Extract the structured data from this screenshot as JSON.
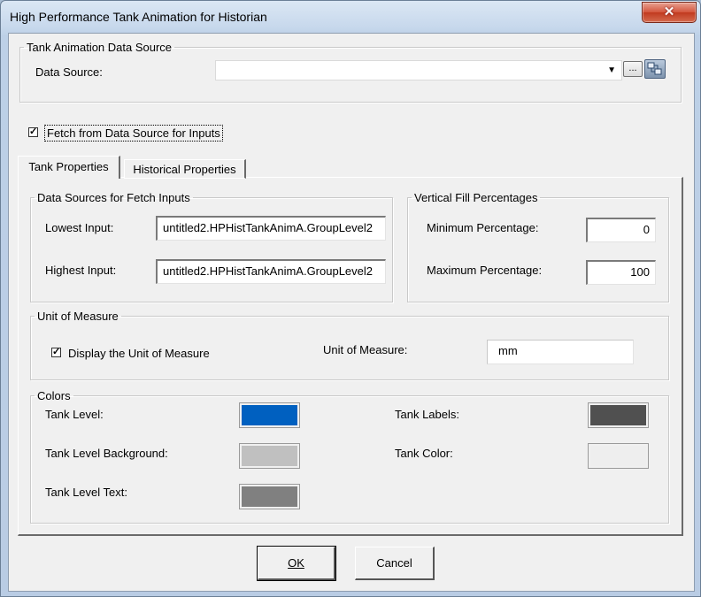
{
  "window": {
    "title": "High Performance Tank Animation for Historian",
    "close_label": "✕"
  },
  "data_source_group": {
    "legend": "Tank Animation Data Source",
    "label": "Data Source:",
    "value": "",
    "browse_label": "...",
    "browse_icon": "tag-browser-icon"
  },
  "fetch": {
    "checked": true,
    "label": "Fetch from Data Source for Inputs"
  },
  "tabs": [
    {
      "label": "Tank Properties",
      "active": true
    },
    {
      "label": "Historical Properties",
      "active": false
    }
  ],
  "fetch_inputs": {
    "legend": "Data Sources for Fetch Inputs",
    "lowest_label": "Lowest Input:",
    "lowest_value": "untitled2.HPHistTankAnimA.GroupLevel2",
    "highest_label": "Highest Input:",
    "highest_value": "untitled2.HPHistTankAnimA.GroupLevel2"
  },
  "fill": {
    "legend": "Vertical Fill Percentages",
    "min_label": "Minimum Percentage:",
    "min_value": "0",
    "max_label": "Maximum Percentage:",
    "max_value": "100"
  },
  "uom": {
    "legend": "Unit of Measure",
    "display_checked": true,
    "display_label": "Display the Unit of Measure",
    "label": "Unit of Measure:",
    "value": "mm"
  },
  "colors": {
    "legend": "Colors",
    "tank_level": {
      "label": "Tank Level:",
      "color": "#0060c0"
    },
    "tank_level_bg": {
      "label": "Tank Level Background:",
      "color": "#c0c0c0"
    },
    "tank_level_text": {
      "label": "Tank Level Text:",
      "color": "#808080"
    },
    "tank_labels": {
      "label": "Tank Labels:",
      "color": "#505050"
    },
    "tank_color": {
      "label": "Tank Color:",
      "color": "#eeeeee"
    }
  },
  "buttons": {
    "ok": "OK",
    "cancel": "Cancel"
  }
}
